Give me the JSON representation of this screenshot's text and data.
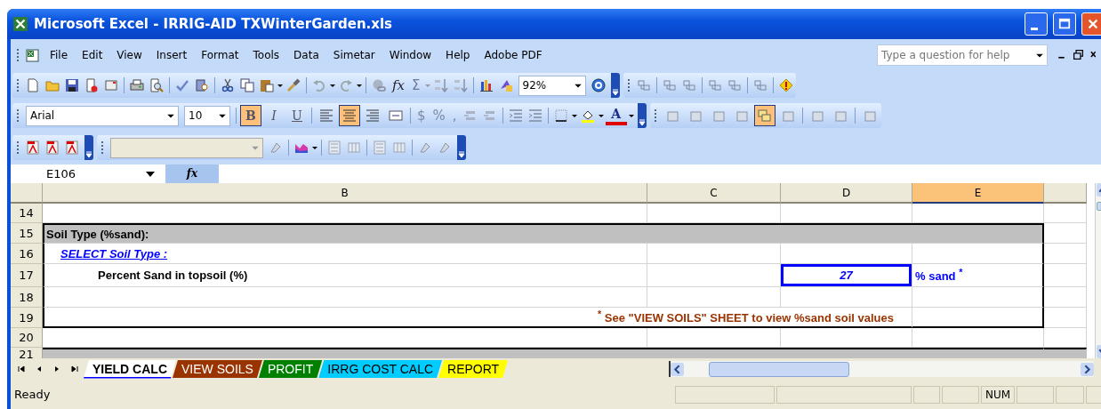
{
  "window": {
    "title": "Microsoft Excel - IRRIG-AID TXWinterGarden.xls"
  },
  "menu": [
    "File",
    "Edit",
    "View",
    "Insert",
    "Format",
    "Tools",
    "Data",
    "Simetar",
    "Window",
    "Help",
    "Adobe PDF"
  ],
  "help_box": {
    "placeholder": "Type a question for help"
  },
  "standard_toolbar": {
    "function_label": "fx",
    "autosum_label": "Σ",
    "zoom": "92%"
  },
  "formatting_toolbar": {
    "font": "Arial",
    "size": "10",
    "styles": [
      {
        "label": "B",
        "kind": "bold",
        "selected": true
      },
      {
        "label": "I",
        "kind": "italic",
        "selected": false
      },
      {
        "label": "U",
        "kind": "underline",
        "selected": false
      }
    ],
    "alignment": [
      {
        "kind": "left",
        "selected": false
      },
      {
        "kind": "center",
        "selected": true
      },
      {
        "kind": "right",
        "selected": false
      },
      {
        "kind": "merge",
        "selected": false
      }
    ],
    "number_formats": [
      "$",
      "%",
      ","
    ],
    "font_color_label": "A"
  },
  "reviewing_toolbar": {
    "buttons": [
      {
        "selected": false
      },
      {
        "selected": false
      },
      {
        "selected": false
      },
      {
        "selected": false
      },
      {
        "selected": true
      },
      {
        "selected": false
      },
      {
        "selected": false
      },
      {
        "selected": false
      },
      {
        "selected": false
      }
    ]
  },
  "formula_bar": {
    "name_box": "E106",
    "function_label": "fx"
  },
  "columns": [
    {
      "label": "B",
      "selected": false
    },
    {
      "label": "C",
      "selected": false
    },
    {
      "label": "D",
      "selected": false
    },
    {
      "label": "E",
      "selected": true
    }
  ],
  "rows": [
    {
      "number": "14",
      "kind": "blank",
      "in_section": false
    },
    {
      "number": "15",
      "kind": "header",
      "in_section": true,
      "text": "Soil Type (%sand):"
    },
    {
      "number": "16",
      "kind": "link",
      "in_section": true,
      "text": "SELECT Soil Type :"
    },
    {
      "number": "17",
      "kind": "input",
      "in_section": true,
      "text": "Percent Sand in topsoil (%)",
      "value": "27",
      "unit": "% sand $^{*}$"
    },
    {
      "number": "18",
      "kind": "blank",
      "in_section": true
    },
    {
      "number": "19",
      "kind": "note",
      "in_section": true,
      "text": "$^{*}$ See \"VIEW SOILS\" SHEET to view %sand soil values"
    },
    {
      "number": "20",
      "kind": "blank",
      "in_section": false
    },
    {
      "number": "21",
      "kind": "header",
      "in_section": false
    }
  ],
  "sheet_tabs": [
    {
      "label": "YIELD CALC",
      "selected": true,
      "color": "#ffffff"
    },
    {
      "label": "VIEW SOILS",
      "selected": false,
      "color": "#993300"
    },
    {
      "label": "PROFIT",
      "selected": false,
      "color": "#008000"
    },
    {
      "label": "IRRG COST CALC",
      "selected": false,
      "color": "#00ccff"
    },
    {
      "label": "REPORT",
      "selected": false,
      "color": "#ffff00"
    }
  ],
  "status_bar": {
    "text": "Ready",
    "indicator": "NUM"
  }
}
